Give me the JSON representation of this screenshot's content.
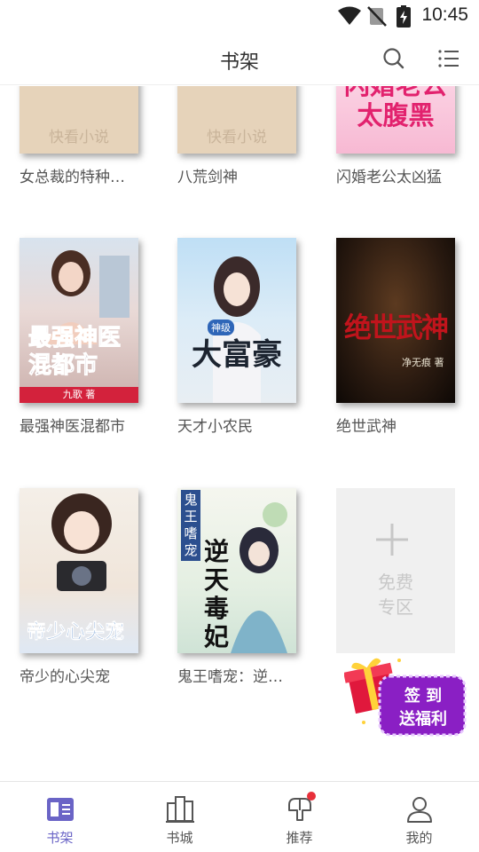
{
  "status_bar": {
    "time": "10:45"
  },
  "header": {
    "title": "书架"
  },
  "books": [
    {
      "title": "女总裁的特种…",
      "cover_text": "快看小说"
    },
    {
      "title": "八荒剑神",
      "cover_text": "快看小说"
    },
    {
      "title": "闪婚老公太凶猛",
      "cover_text": "闪婚老公太腹黑"
    },
    {
      "title": "最强神医混都市",
      "cover_text": "最强神医混都市",
      "author": "九歌"
    },
    {
      "title": "天才小农民",
      "cover_text": "大富豪",
      "cover_badge": "神级"
    },
    {
      "title": "绝世武神",
      "cover_text": "绝世武神",
      "author": "净无痕"
    },
    {
      "title": "帝少的心尖宠",
      "cover_text": "帝少心尖宠"
    },
    {
      "title": "鬼王嗜宠：逆…",
      "cover_text": "逆天毒妃",
      "cover_badge": "鬼王嗜宠"
    }
  ],
  "add_card": {
    "line1": "免费",
    "line2": "专区"
  },
  "promo": {
    "line1": "签 到",
    "line2": "送福利"
  },
  "nav": [
    {
      "label": "书架",
      "icon": "bookshelf-icon",
      "active": true
    },
    {
      "label": "书城",
      "icon": "bookstore-icon",
      "active": false
    },
    {
      "label": "推荐",
      "icon": "recommend-icon",
      "active": false,
      "badge": true
    },
    {
      "label": "我的",
      "icon": "profile-icon",
      "active": false
    }
  ],
  "colors": {
    "accent": "#6a64c6",
    "badge": "#e8303a",
    "placeholder": "#e6d3ba"
  }
}
